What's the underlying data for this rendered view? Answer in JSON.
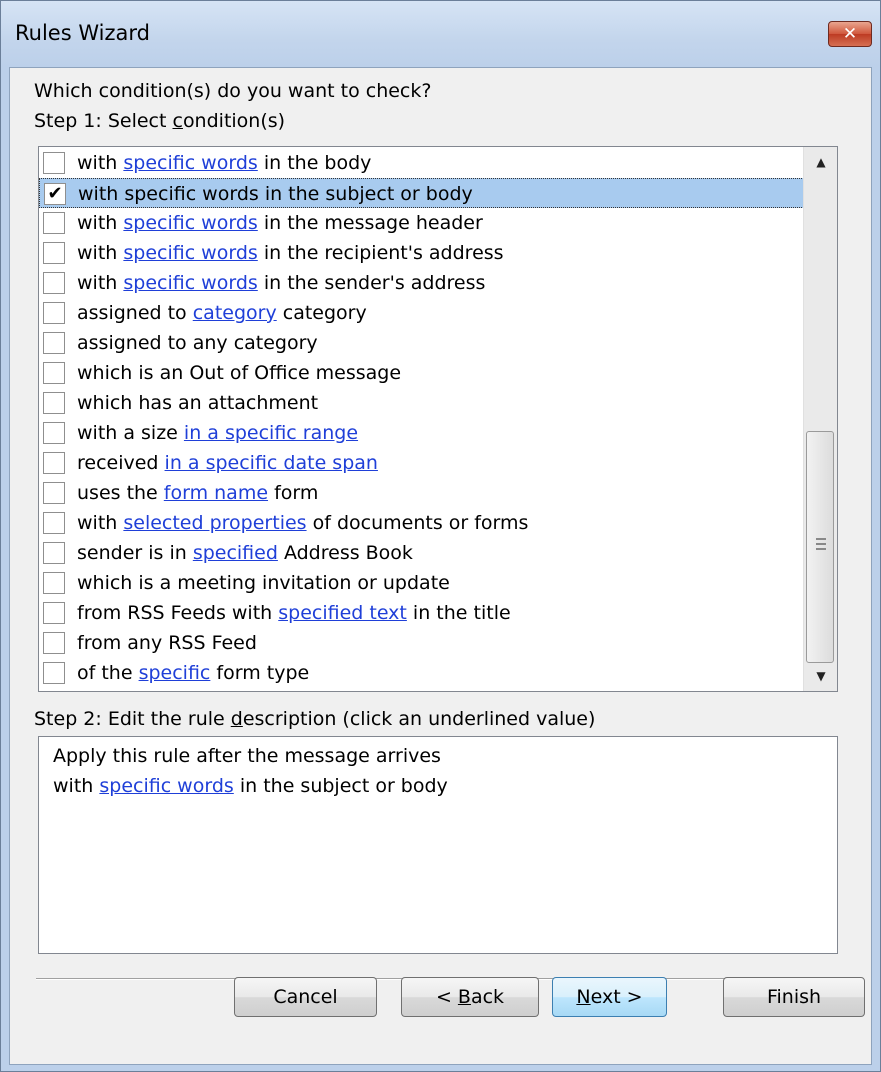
{
  "window": {
    "title": "Rules Wizard",
    "close_glyph": "✕"
  },
  "prompt": "Which condition(s) do you want to check?",
  "step1": {
    "before": "Step 1: Select ",
    "access_key": "c",
    "after": "ondition(s)"
  },
  "conditions": [
    {
      "checked": false,
      "parts": [
        [
          "with ",
          false
        ],
        [
          "specific words",
          true
        ],
        [
          " in the body",
          false
        ]
      ]
    },
    {
      "checked": true,
      "parts": [
        [
          "with specific words in the subject or body",
          false
        ]
      ]
    },
    {
      "checked": false,
      "parts": [
        [
          "with ",
          false
        ],
        [
          "specific words",
          true
        ],
        [
          " in the message header",
          false
        ]
      ]
    },
    {
      "checked": false,
      "parts": [
        [
          "with ",
          false
        ],
        [
          "specific words",
          true
        ],
        [
          " in the recipient's address",
          false
        ]
      ]
    },
    {
      "checked": false,
      "parts": [
        [
          "with ",
          false
        ],
        [
          "specific words",
          true
        ],
        [
          " in the sender's address",
          false
        ]
      ]
    },
    {
      "checked": false,
      "parts": [
        [
          "assigned to ",
          false
        ],
        [
          "category",
          true
        ],
        [
          " category",
          false
        ]
      ]
    },
    {
      "checked": false,
      "parts": [
        [
          "assigned to any category",
          false
        ]
      ]
    },
    {
      "checked": false,
      "parts": [
        [
          "which is an Out of Office message",
          false
        ]
      ]
    },
    {
      "checked": false,
      "parts": [
        [
          "which has an attachment",
          false
        ]
      ]
    },
    {
      "checked": false,
      "parts": [
        [
          "with a size ",
          false
        ],
        [
          "in a specific range",
          true
        ]
      ]
    },
    {
      "checked": false,
      "parts": [
        [
          "received ",
          false
        ],
        [
          "in a specific date span",
          true
        ]
      ]
    },
    {
      "checked": false,
      "parts": [
        [
          "uses the ",
          false
        ],
        [
          "form name",
          true
        ],
        [
          " form",
          false
        ]
      ]
    },
    {
      "checked": false,
      "parts": [
        [
          "with ",
          false
        ],
        [
          "selected properties",
          true
        ],
        [
          " of documents or forms",
          false
        ]
      ]
    },
    {
      "checked": false,
      "parts": [
        [
          "sender is in ",
          false
        ],
        [
          "specified",
          true
        ],
        [
          " Address Book",
          false
        ]
      ]
    },
    {
      "checked": false,
      "parts": [
        [
          "which is a meeting invitation or update",
          false
        ]
      ]
    },
    {
      "checked": false,
      "parts": [
        [
          "from RSS Feeds with ",
          false
        ],
        [
          "specified text",
          true
        ],
        [
          " in the title",
          false
        ]
      ]
    },
    {
      "checked": false,
      "parts": [
        [
          "from any RSS Feed",
          false
        ]
      ]
    },
    {
      "checked": false,
      "parts": [
        [
          "of the ",
          false
        ],
        [
          "specific",
          true
        ],
        [
          " form type",
          false
        ]
      ]
    }
  ],
  "check_glyph": "✔",
  "scroll": {
    "up_glyph": "▲",
    "down_glyph": "▼"
  },
  "step2": {
    "before": "Step 2: Edit the rule ",
    "access_key": "d",
    "after": "escription (click an underlined value)"
  },
  "description": {
    "line1": "Apply this rule after the message arrives",
    "line2_before": "with ",
    "line2_link": "specific words",
    "line2_after": " in the subject or body"
  },
  "buttons": {
    "cancel": "Cancel",
    "back_before": "< ",
    "back_key": "B",
    "back_after": "ack",
    "next_key": "N",
    "next_after": "ext >",
    "finish": "Finish"
  }
}
